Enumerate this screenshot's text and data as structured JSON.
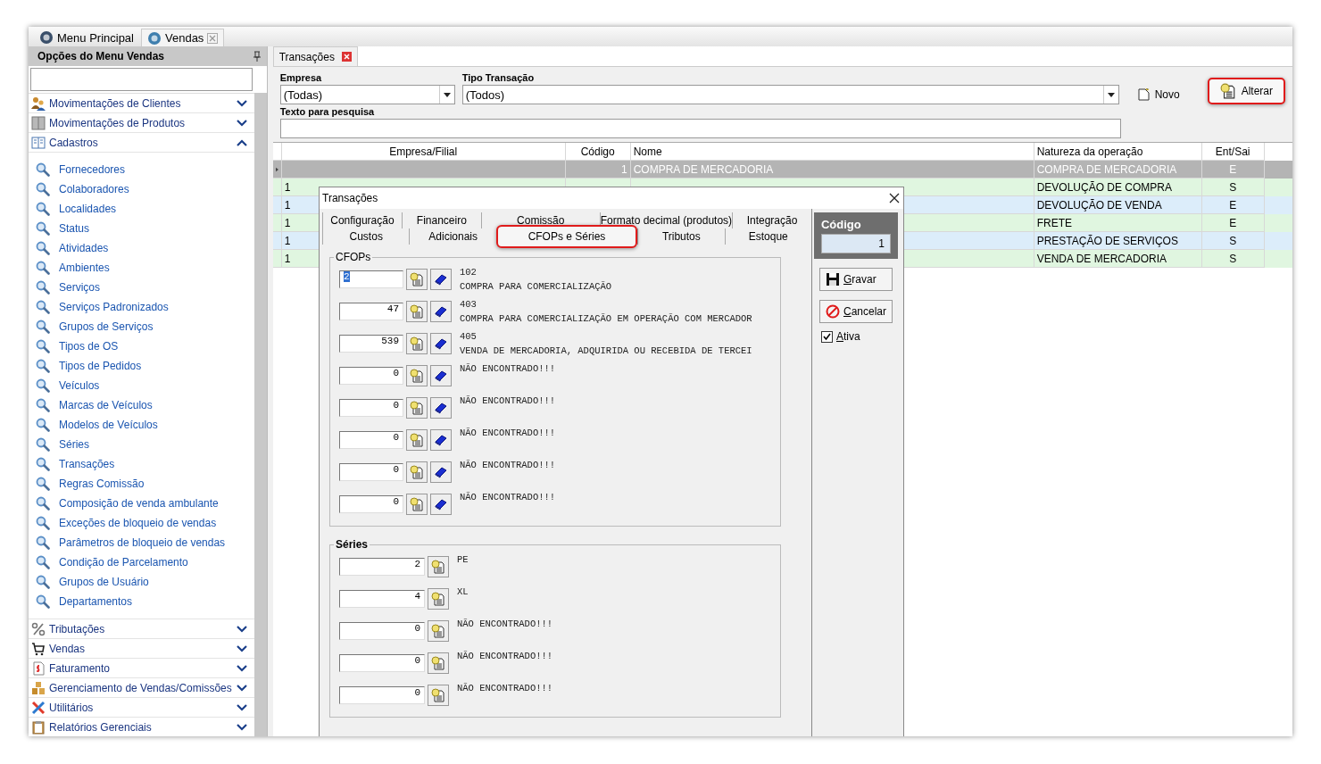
{
  "main_tabs": [
    {
      "label": "Menu Principal",
      "selected": false,
      "closable": false
    },
    {
      "label": "Vendas",
      "selected": true,
      "closable": true
    }
  ],
  "sidebar": {
    "title": "Opções do Menu Vendas",
    "groups": [
      {
        "label": "Movimentações de Clientes",
        "kind": "people",
        "expanded": false
      },
      {
        "label": "Movimentações de Produtos",
        "kind": "box",
        "expanded": false
      },
      {
        "label": "Cadastros",
        "kind": "book",
        "expanded": true,
        "children": [
          "Fornecedores",
          "Colaboradores",
          "Localidades",
          "Status",
          "Atividades",
          "Ambientes",
          "Serviços",
          "Serviços Padronizados",
          "Grupos de Serviços",
          "Tipos de OS",
          "Tipos de Pedidos",
          "Veículos",
          "Marcas de Veículos",
          "Modelos de Veículos",
          "Séries",
          "Transações",
          "Regras Comissão",
          "Composição de venda ambulante",
          "Exceções de bloqueio de vendas",
          "Parâmetros de bloqueio de vendas",
          "Condição de Parcelamento",
          "Grupos de Usuário",
          "Departamentos"
        ]
      },
      {
        "label": "Tributações",
        "kind": "percent",
        "expanded": false
      },
      {
        "label": "Vendas",
        "kind": "cart",
        "expanded": false
      },
      {
        "label": "Faturamento",
        "kind": "invoice",
        "expanded": false
      },
      {
        "label": "Gerenciamento de Vendas/Comissões",
        "kind": "boxes",
        "expanded": false
      },
      {
        "label": "Utilitários",
        "kind": "tools",
        "expanded": false
      },
      {
        "label": "Relatórios Gerenciais",
        "kind": "clipboard",
        "expanded": false
      }
    ]
  },
  "document_tab": {
    "label": "Transações"
  },
  "filters": {
    "empresa": {
      "label": "Empresa",
      "value": "(Todas)"
    },
    "tipo": {
      "label": "Tipo Transação",
      "value": "(Todos)"
    },
    "search_label": "Texto para pesquisa"
  },
  "toolbar": [
    {
      "label": "Novo",
      "kind": "new",
      "highlighted": false
    },
    {
      "label": "Alterar",
      "kind": "edit",
      "highlighted": true
    }
  ],
  "table": {
    "columns": [
      "Empresa/Filial",
      "Código",
      "Nome",
      "Natureza da operação",
      "Ent/Sai"
    ],
    "rows": [
      {
        "selected": true,
        "codigo": "1",
        "nome": "COMPRA DE MERCADORIA",
        "natureza": "COMPRA DE MERCADORIA",
        "ent_sai": "E"
      },
      {
        "selected": false,
        "empresa": "1",
        "natureza": "DEVOLUÇÃO DE COMPRA",
        "ent_sai": "S"
      },
      {
        "selected": false,
        "empresa": "1",
        "natureza": "DEVOLUÇÃO DE VENDA",
        "ent_sai": "E"
      },
      {
        "selected": false,
        "empresa": "1",
        "natureza": "FRETE",
        "ent_sai": "E"
      },
      {
        "selected": false,
        "empresa": "1",
        "natureza": "PRESTAÇÃO DE SERVIÇOS",
        "ent_sai": "S"
      },
      {
        "selected": false,
        "empresa": "1",
        "natureza": "VENDA DE MERCADORIA",
        "ent_sai": "S"
      }
    ]
  },
  "dialog": {
    "title": "Transações",
    "tab_rows": [
      [
        {
          "label": "Configuração",
          "selected": false,
          "highlighted": false
        },
        {
          "label": "Financeiro",
          "selected": false,
          "highlighted": false
        },
        {
          "label": "Comissão",
          "selected": false,
          "highlighted": false
        },
        {
          "label": "Formato decimal (produtos)",
          "selected": false,
          "highlighted": false
        },
        {
          "label": "Integração",
          "selected": false,
          "highlighted": false
        }
      ],
      [
        {
          "label": "Custos",
          "selected": false,
          "highlighted": false
        },
        {
          "label": "Adicionais",
          "selected": false,
          "highlighted": false
        },
        {
          "label": "CFOPs e Séries",
          "selected": true,
          "highlighted": true
        },
        {
          "label": "Tributos",
          "selected": false,
          "highlighted": false
        },
        {
          "label": "Estoque",
          "selected": false,
          "highlighted": false
        }
      ]
    ],
    "cfops_title": "CFOPs",
    "cfops": [
      {
        "value": "2",
        "focused": true,
        "code": "102",
        "description": "COMPRA PARA COMERCIALIZAÇÃO"
      },
      {
        "value": "47",
        "focused": false,
        "code": "403",
        "description": "COMPRA PARA COMERCIALIZAÇÃO EM OPERAÇÃO COM MERCADOR"
      },
      {
        "value": "539",
        "focused": false,
        "code": "405",
        "description": "VENDA DE MERCADORIA, ADQUIRIDA OU RECEBIDA DE TERCEI"
      },
      {
        "value": "0",
        "focused": false,
        "description": "NÃO ENCONTRADO!!!"
      },
      {
        "value": "0",
        "focused": false,
        "description": "NÃO ENCONTRADO!!!"
      },
      {
        "value": "0",
        "focused": false,
        "description": "NÃO ENCONTRADO!!!"
      },
      {
        "value": "0",
        "focused": false,
        "description": "NÃO ENCONTRADO!!!"
      },
      {
        "value": "0",
        "focused": false,
        "description": "NÃO ENCONTRADO!!!"
      }
    ],
    "series_title": "Séries",
    "series": [
      {
        "value": "2",
        "description": "PE"
      },
      {
        "value": "4",
        "description": "XL"
      },
      {
        "value": "0",
        "description": "NÃO ENCONTRADO!!!"
      },
      {
        "value": "0",
        "description": "NÃO ENCONTRADO!!!"
      },
      {
        "value": "0",
        "description": "NÃO ENCONTRADO!!!"
      }
    ],
    "codigo": {
      "label": "Código",
      "value": "1"
    },
    "buttons": [
      {
        "label": "Gravar",
        "kind": "save"
      },
      {
        "label": "Cancelar",
        "kind": "cancel"
      }
    ],
    "ativa": {
      "label": "Ativa",
      "checked": true
    }
  }
}
